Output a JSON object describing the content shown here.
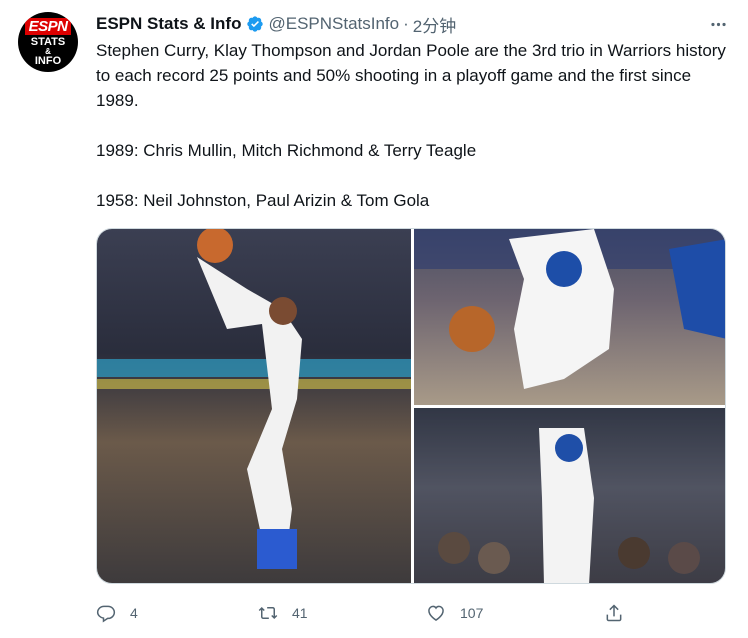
{
  "author": {
    "name": "ESPN Stats & Info",
    "handle": "@ESPNStatsInfo",
    "separator": "·",
    "time": "2分钟",
    "avatar": {
      "logo": "ESPN",
      "line1": "STATS",
      "line2": "&",
      "line3": "INFO"
    },
    "verified_color": "#1d9bf0"
  },
  "tweet": {
    "line1": "Stephen Curry, Klay Thompson and Jordan Poole are the 3rd trio in Warriors history to each record 25 points and 50% shooting in a playoff game and the first since 1989.",
    "line2": "1989: Chris Mullin, Mitch Richmond & Terry Teagle",
    "line3": "1958: Neil Johnston, Paul Arizin & Tom Gola"
  },
  "media": {
    "photos": [
      {
        "icon": "photo-curry-layup"
      },
      {
        "icon": "photo-player-dribbling"
      },
      {
        "icon": "photo-player-crowd"
      }
    ]
  },
  "actions": {
    "reply_count": "4",
    "retweet_count": "41",
    "like_count": "107"
  },
  "colors": {
    "text": "#0f1419",
    "secondary": "#536471",
    "accent": "#1d9bf0"
  }
}
